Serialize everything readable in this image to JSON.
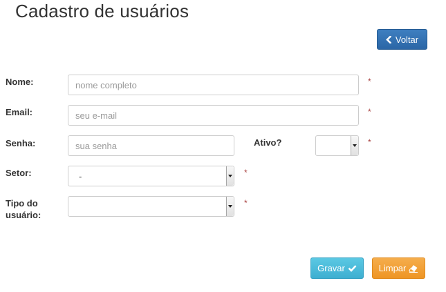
{
  "page": {
    "title": "Cadastro de usuários"
  },
  "header": {
    "back_label": "Voltar",
    "back_icon": "chevron-left-icon"
  },
  "form": {
    "name": {
      "label": "Nome:",
      "placeholder": "nome completo",
      "value": ""
    },
    "email": {
      "label": "Email:",
      "placeholder": "seu e-mail",
      "value": ""
    },
    "password": {
      "label": "Senha:",
      "placeholder": "sua senha",
      "value": ""
    },
    "active": {
      "label": "Ativo?",
      "selected": ""
    },
    "sector": {
      "label": "Setor:",
      "selected": "-"
    },
    "user_type": {
      "label_line1": "Tipo do",
      "label_line2": "usuário:",
      "selected": ""
    },
    "required_marker": "*"
  },
  "actions": {
    "save_label": "Gravar",
    "save_icon": "check-icon",
    "clear_label": "Limpar",
    "clear_icon": "eraser-icon"
  },
  "colors": {
    "primary": "#2b66a6",
    "info": "#3eafd1",
    "warning": "#ee9524",
    "required": "#a94442"
  }
}
